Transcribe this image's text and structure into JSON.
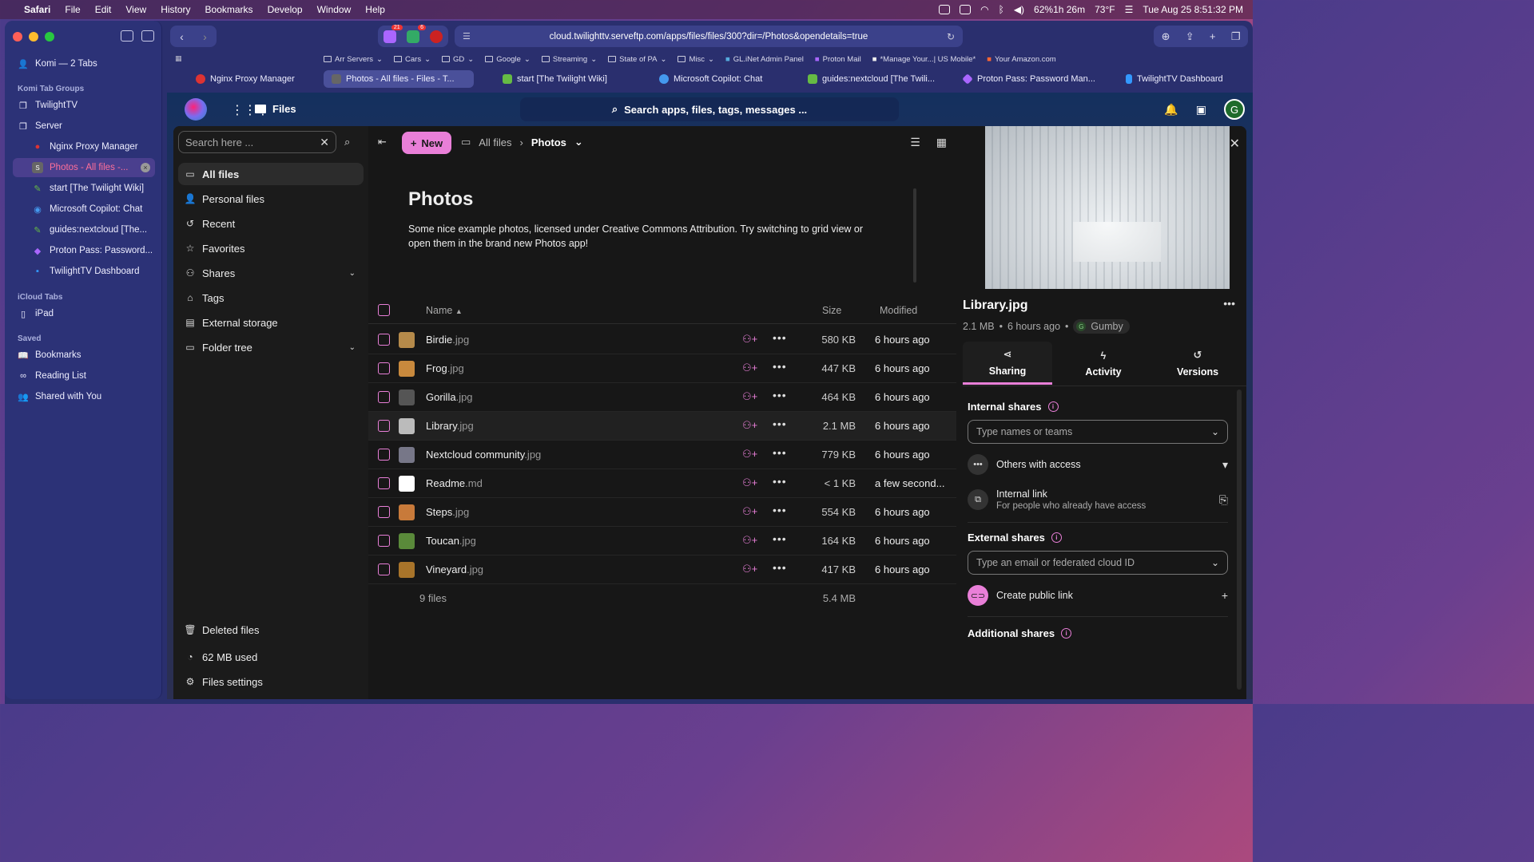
{
  "menubar": {
    "app": "Safari",
    "items": [
      "File",
      "Edit",
      "View",
      "History",
      "Bookmarks",
      "Develop",
      "Window",
      "Help"
    ],
    "battery": "62%1h 26m",
    "weather": "73°F",
    "datetime": "Tue Aug 25  8:51:32 PM"
  },
  "browser": {
    "url": "cloud.twilighttv.serveftp.com/apps/files/files/300?dir=/Photos&opendetails=true",
    "extension_badges": [
      "21",
      "6"
    ],
    "favorites": [
      "Arr Servers",
      "Cars",
      "GD",
      "Google",
      "Streaming",
      "State of PA",
      "Misc",
      "GL.iNet Admin Panel",
      "Proton Mail",
      "*Manage Your...| US Mobile*",
      "Your Amazon.com"
    ],
    "tabs": [
      {
        "label": "Nginx Proxy Manager",
        "color": "#d33"
      },
      {
        "label": "Photos - All files - Files - T...",
        "color": "#555"
      },
      {
        "label": "start [The Twilight Wiki]",
        "color": "#6b4"
      },
      {
        "label": "Microsoft Copilot: Chat",
        "color": "#49e"
      },
      {
        "label": "guides:nextcloud [The Twili...",
        "color": "#6b4"
      },
      {
        "label": "Proton Pass: Password Man...",
        "color": "#a6f"
      },
      {
        "label": "TwilightTV Dashboard",
        "color": "#39f"
      }
    ]
  },
  "safari_sidebar": {
    "profile": "Komi — 2 Tabs",
    "groups_heading": "Komi Tab Groups",
    "groups": [
      "TwilightTV",
      "Server"
    ],
    "server_tabs": [
      "Nginx Proxy Manager",
      "Photos - All files -...",
      "start [The Twilight Wiki]",
      "Microsoft Copilot: Chat",
      "guides:nextcloud [The...",
      "Proton Pass: Password...",
      "TwilightTV Dashboard"
    ],
    "icloud_heading": "iCloud Tabs",
    "icloud_items": [
      "iPad"
    ],
    "saved_heading": "Saved",
    "saved_items": [
      "Bookmarks",
      "Reading List",
      "Shared with You"
    ]
  },
  "nextcloud": {
    "app_title": "Files",
    "unified_search_placeholder": "Search apps, files, tags, messages ...",
    "avatar_letter": "G",
    "nav": {
      "search_placeholder": "Search here ...",
      "items": [
        "All files",
        "Personal files",
        "Recent",
        "Favorites",
        "Shares",
        "Tags",
        "External storage",
        "Folder tree"
      ],
      "bottom": [
        "Deleted files",
        "62 MB used",
        "Files settings"
      ]
    },
    "toolbar": {
      "new_label": "New",
      "crumb_root": "All files",
      "crumb_current": "Photos"
    },
    "readme": {
      "title": "Photos",
      "text": "Some nice example photos, licensed under Creative Commons Attribution. Try switching to grid view or open them in the brand new Photos app!"
    },
    "columns": {
      "name": "Name",
      "size": "Size",
      "modified": "Modified"
    },
    "files": [
      {
        "name": "Birdie",
        "ext": ".jpg",
        "size": "580 KB",
        "modified": "6 hours ago",
        "thumb": "#b58a4a"
      },
      {
        "name": "Frog",
        "ext": ".jpg",
        "size": "447 KB",
        "modified": "6 hours ago",
        "thumb": "#c8893d"
      },
      {
        "name": "Gorilla",
        "ext": ".jpg",
        "size": "464 KB",
        "modified": "6 hours ago",
        "thumb": "#555"
      },
      {
        "name": "Library",
        "ext": ".jpg",
        "size": "2.1 MB",
        "modified": "6 hours ago",
        "thumb": "#bbb"
      },
      {
        "name": "Nextcloud community",
        "ext": ".jpg",
        "size": "779 KB",
        "modified": "6 hours ago",
        "thumb": "#778"
      },
      {
        "name": "Readme",
        "ext": ".md",
        "size": "< 1 KB",
        "modified": "a few second...",
        "thumb": "#fff"
      },
      {
        "name": "Steps",
        "ext": ".jpg",
        "size": "554 KB",
        "modified": "6 hours ago",
        "thumb": "#c87a3a"
      },
      {
        "name": "Toucan",
        "ext": ".jpg",
        "size": "164 KB",
        "modified": "6 hours ago",
        "thumb": "#5a8a3a"
      },
      {
        "name": "Vineyard",
        "ext": ".jpg",
        "size": "417 KB",
        "modified": "6 hours ago",
        "thumb": "#a8742a"
      }
    ],
    "footer": {
      "count": "9 files",
      "total": "5.4 MB"
    },
    "details": {
      "filename": "Library.jpg",
      "size": "2.1 MB",
      "age": "6 hours ago",
      "owner": "Gumby",
      "tabs": [
        "Sharing",
        "Activity",
        "Versions"
      ],
      "internal_heading": "Internal shares",
      "internal_placeholder": "Type names or teams",
      "others_access": "Others with access",
      "internal_link": "Internal link",
      "internal_link_sub": "For people who already have access",
      "external_heading": "External shares",
      "external_placeholder": "Type an email or federated cloud ID",
      "public_link": "Create public link",
      "additional_heading": "Additional shares"
    }
  }
}
